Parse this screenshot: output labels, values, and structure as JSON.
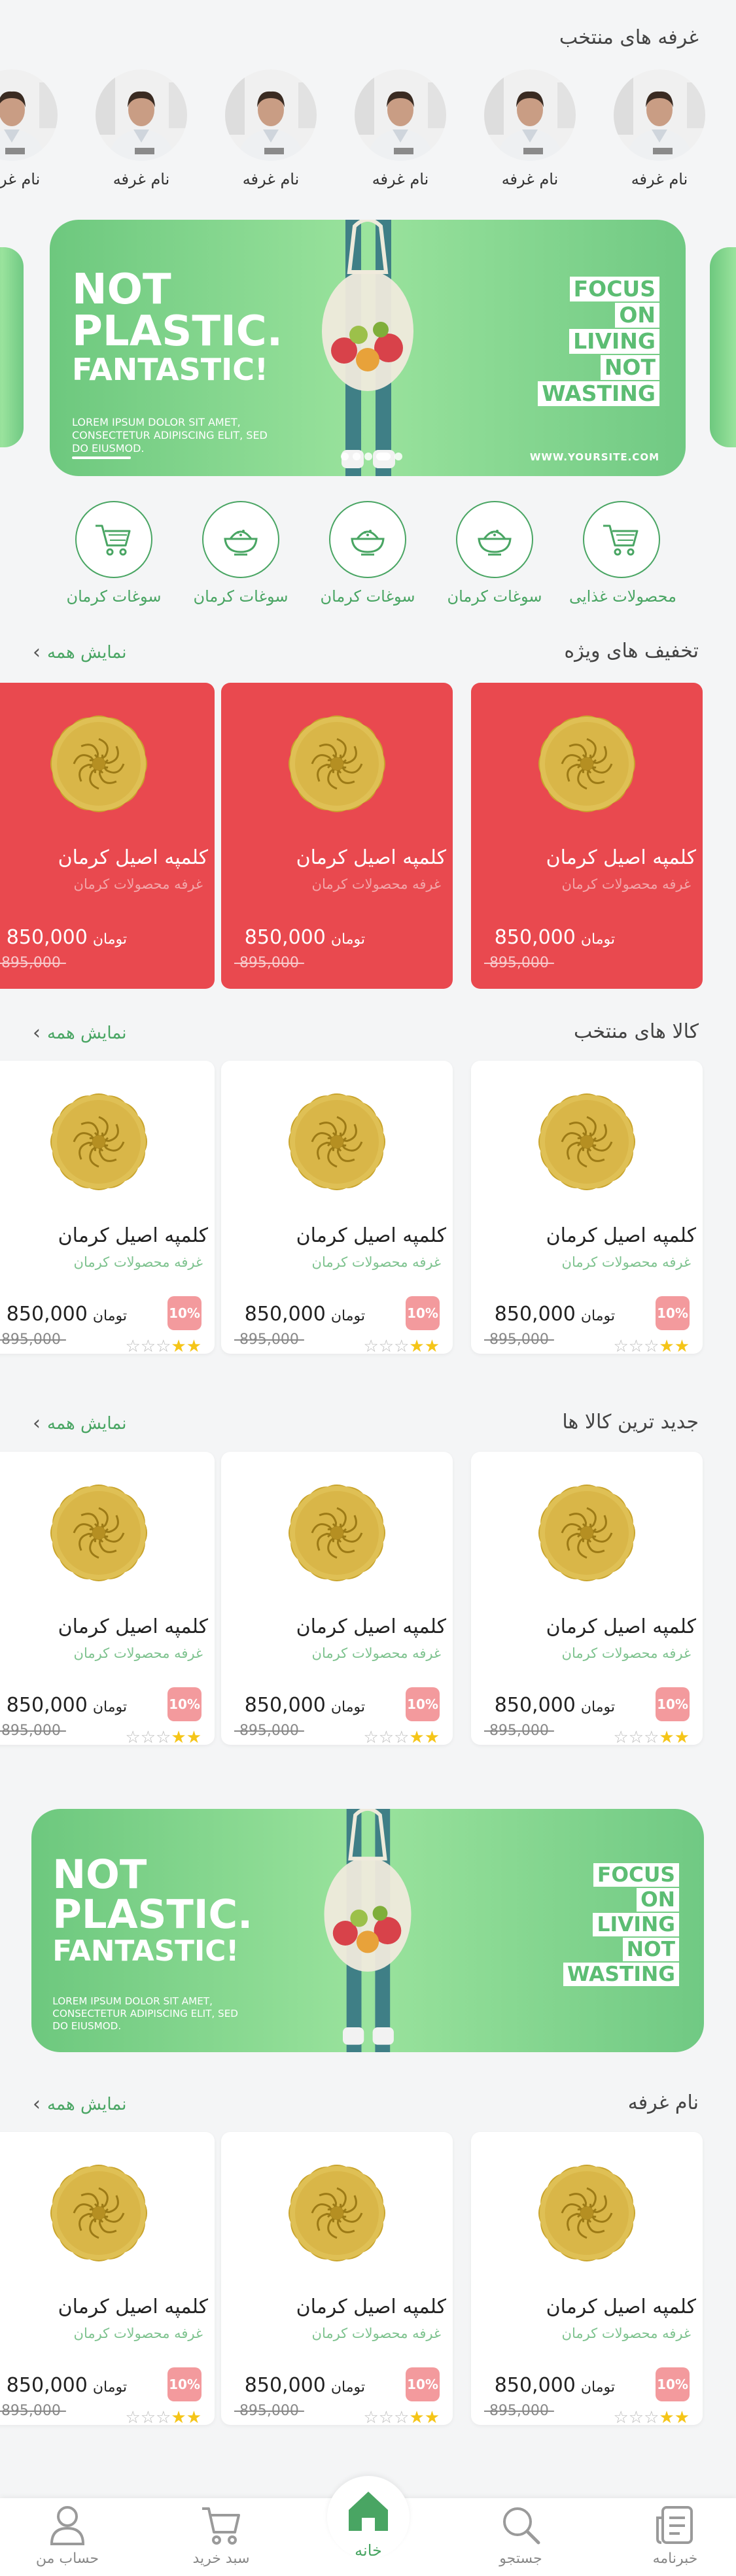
{
  "stories": {
    "title": "غرفه های منتخب",
    "items": [
      "نام غرفه",
      "نام غرفه",
      "نام غرفه",
      "نام غرفه",
      "نام غرفه",
      "نام غرفه"
    ],
    "partial": "نام غرفه"
  },
  "banner": {
    "line1": "NOT",
    "line2": "PLASTIC.",
    "line3": "FANTASTIC!",
    "lorem": "LOREM IPSUM DOLOR SIT AMET, CONSECTETUR ADIPISCING ELIT, SED DO EIUSMOD.",
    "r1": "FOCUS",
    "r2": "ON",
    "r3": "LIVING",
    "r4": "NOT",
    "r5": "WASTING",
    "site": "WWW.YOURSITE.COM"
  },
  "categories": [
    "محصولات غذایی",
    "سوغات کرمان",
    "سوغات کرمان",
    "سوغات کرمان",
    "سوغات کرمان"
  ],
  "special": {
    "title": "تخفیف های ویژه",
    "show_all": "نمایش همه"
  },
  "featured": {
    "title": "کالا های منتخب",
    "show_all": "نمایش همه"
  },
  "newest": {
    "title": "جدید ترین کالا ها",
    "show_all": "نمایش همه"
  },
  "booth": {
    "title": "نام غرفه",
    "show_all": "نمایش همه"
  },
  "product": {
    "name": "کلمپه اصیل کرمان",
    "shop": "غرفه محصولات کرمان",
    "price": "850,000",
    "unit": "تومان",
    "old_price": "-895,000-",
    "discount": "10%",
    "rating": 2
  },
  "nav": {
    "profile": "حساب من",
    "cart": "سبد خرید",
    "home": "خانه",
    "search": "جستجو",
    "blog": "خبرنامه"
  },
  "colors": {
    "accent": "#49a563",
    "red_card": "#e9494f",
    "banner_green": "#6dc87e"
  }
}
